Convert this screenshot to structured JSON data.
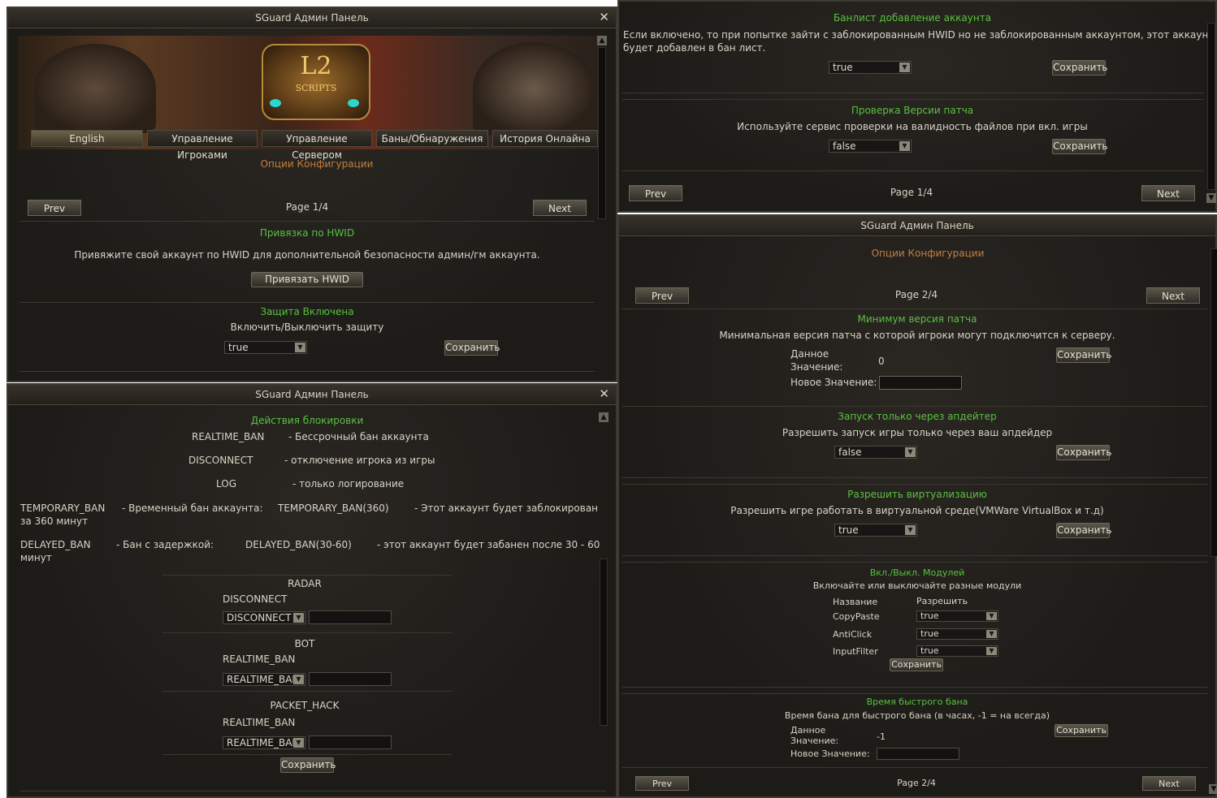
{
  "win1": {
    "title": "SGuard Админ Панель",
    "close": "✕",
    "tabs": [
      "English",
      "Управление Игроками",
      "Управление Сервером",
      "Баны/Обнаружения",
      "История Онлайна"
    ],
    "logo": {
      "line1": "L2",
      "line2": "SCRIPTS"
    },
    "section": "Опции Конфигурации",
    "prev": "Prev",
    "next": "Next",
    "page": "Page 1/4",
    "hwid": {
      "title": "Привязка по HWID",
      "desc": "Привяжите свой аккаунт по HWID для дополнительной безопасности админ/гм аккаунта.",
      "button": "Привязать HWID"
    },
    "protection": {
      "title": "Защита Включена",
      "desc": "Включить/Выключить защиту",
      "value": "true",
      "save": "Сохранить"
    }
  },
  "win2": {
    "title": "SGuard Админ Панель",
    "close": "✕",
    "actions_title": "Действия блокировки",
    "actions": [
      {
        "key": "REALTIME_BAN",
        "desc": "- Бессрочный бан аккаунта"
      },
      {
        "key": "DISCONNECT",
        "desc": "- отключение игрока из игры"
      },
      {
        "key": "LOG",
        "desc": "- только логирование"
      }
    ],
    "temp": {
      "key": "TEMPORARY_BAN",
      "desc": "- Временный бан аккаунта:",
      "example": "TEMPORARY_BAN(360)",
      "note": "- Этот аккаунт будет заблокирован",
      "cont": "за 360 минут"
    },
    "delayed": {
      "key": "DELAYED_BAN",
      "desc": "- Бан с задержкой:",
      "example": "DELAYED_BAN(30-60)",
      "note": "- этот аккаунт будет забанен после 30 - 60",
      "cont": "минут"
    },
    "detections": [
      {
        "name": "RADAR",
        "current": "DISCONNECT",
        "select": "DISCONNECT"
      },
      {
        "name": "BOT",
        "current": "REALTIME_BAN",
        "select": "REALTIME_BAI"
      },
      {
        "name": "PACKET_HACK",
        "current": "REALTIME_BAN",
        "select": "REALTIME_BAI"
      }
    ],
    "save": "Сохранить"
  },
  "win3": {
    "banlist": {
      "title": "Банлист добавление аккаунта",
      "desc1": "Если включено, то при попытке зайти с заблокированным HWID но не заблокированным аккаунтом, этот аккаунт",
      "desc2": "будет добавлен в бан лист.",
      "value": "true",
      "save": "Сохранить"
    },
    "patch": {
      "title": "Проверка Версии патча",
      "desc": "Используйте сервис проверки на валидность файлов при вкл. игры",
      "value": "false",
      "save": "Сохранить"
    },
    "prev": "Prev",
    "next": "Next",
    "page": "Page 1/4"
  },
  "win4": {
    "title": "SGuard Админ Панель",
    "section": "Опции Конфигурации",
    "prev": "Prev",
    "next": "Next",
    "page": "Page 2/4",
    "min_patch": {
      "title": "Минимум версия патча",
      "desc": "Минимальная версия патча с которой игроки могут подключится к серверу.",
      "cur_label1": "Данное",
      "cur_label2": "Значение:",
      "cur_value": "0",
      "new_label": "Новое Значение:",
      "save": "Сохранить"
    },
    "updater": {
      "title": "Запуск только через апдейтер",
      "desc": "Разрешить запуск игры только через ваш апдейдер",
      "value": "false",
      "save": "Сохранить"
    },
    "virt": {
      "title": "Разрешить виртуализацию",
      "desc": "Разрешить игре работать в виртуальной среде(VMWare VirtualBox и т.д)",
      "value": "true",
      "save": "Сохранить"
    },
    "modules": {
      "title": "Вкл./Выкл. Модулей",
      "desc": "Включайте или выключайте разные модули",
      "col_name": "Название",
      "col_allow": "Разрешить",
      "items": [
        {
          "name": "CopyPaste",
          "value": "true"
        },
        {
          "name": "AntiClick",
          "value": "true"
        },
        {
          "name": "InputFilter",
          "value": "true"
        }
      ],
      "save": "Сохранить"
    },
    "fastban": {
      "title": "Время быстрого бана",
      "desc": "Время бана для быстрого бана (в часах, -1 = на всегда)",
      "cur_label1": "Данное",
      "cur_label2": "Значение:",
      "cur_value": "-1",
      "new_label": "Новое Значение:",
      "save": "Сохранить"
    },
    "page_bottom": "Page 2/4"
  },
  "colors": {
    "green": "#58c13f",
    "orange": "#c57f3e",
    "panel": "#1f1d19"
  }
}
